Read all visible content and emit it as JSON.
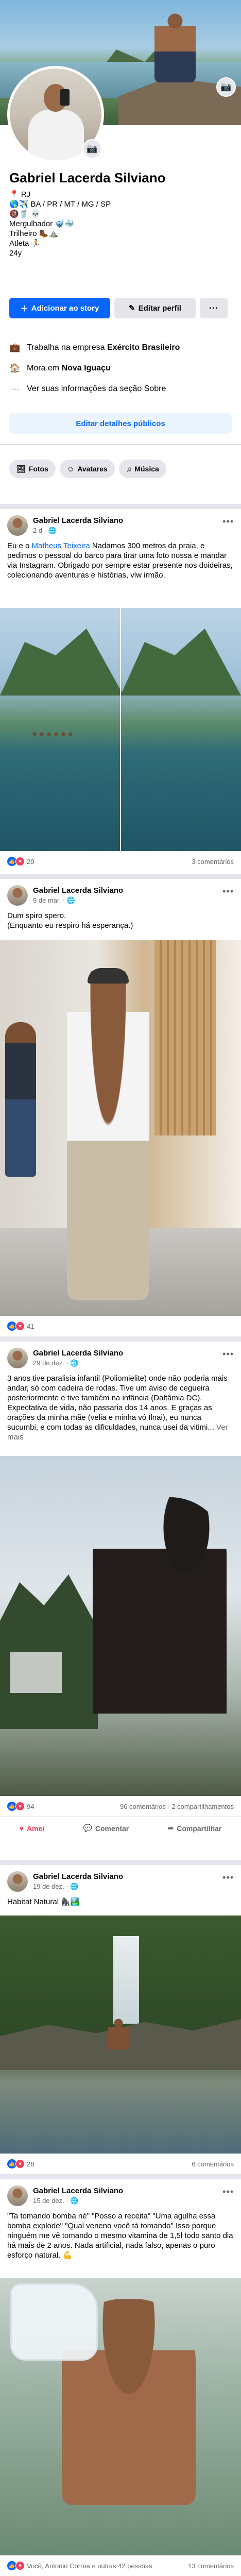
{
  "profile": {
    "name": "Gabriel Lacerda Silviano",
    "bio": [
      "📍 RJ",
      "🌎✈️ BA / PR / MT / MG / SP",
      "🔞🥤 💀",
      "Mergulhador 🤿🐳",
      "Trilheiro 🥾⛰️",
      "Atleta 🏃",
      "24y"
    ],
    "add_story_label": "Adicionar ao story",
    "edit_profile_label": "Editar perfil",
    "more_label": "···",
    "info": {
      "work_prefix": "Trabalha na empresa ",
      "work_company": "Exército Brasileiro",
      "home_prefix": "Mora em ",
      "home_city": "Nova Iguaçu",
      "about_text": "Ver suas informações da seção Sobre"
    },
    "details_label": "Editar detalhes públicos",
    "chips": [
      {
        "icon": "photos-icon",
        "label": "Fotos"
      },
      {
        "icon": "avatars-icon",
        "label": "Avatares"
      },
      {
        "icon": "music-icon",
        "label": "Música"
      }
    ]
  },
  "posts": [
    {
      "author": "Gabriel Lacerda Silviano",
      "time": "2 d · 🌐",
      "text_before": "Eu e o ",
      "mention": "Matheus Teixeira",
      "text_after": " Nadamos 300 metros da praia, e pedimos o pessoal do barco para tirar uma foto nossa e mandar via Instagram. Obrigado por sempre estar presente nos doideiras, colecionando aventuras e histórias, vlw irmão.",
      "reactions": "29",
      "stats_right": "3 comentários"
    },
    {
      "author": "Gabriel Lacerda Silviano",
      "time": "9 de mar. · 🌐",
      "text_lines": [
        "Dum spiro spero.",
        "(Enquanto eu respiro há esperança.)"
      ],
      "reactions": "41",
      "stats_right": ""
    },
    {
      "author": "Gabriel Lacerda Silviano",
      "time": "29 de dez. · 🌐",
      "text": "3 anos tive paralisia infantil (Poliomielite) onde não poderia mais andar, só com cadeira de rodas. Tive um aviso de cegueira posteriormente e tive também na infância (Daltâmia DC). Expectativa de vida, não passaria dos 14 anos. E graças as orações da minha mãe (velia e minha vó Ilnai), eu nunca sucumbi, e com todas as dificuldades, nunca usei da vitimi...",
      "see_more": "Ver mais",
      "reactions": "94",
      "stats_right": "96 comentários · 2 compartilhamentos",
      "actions": {
        "love": "Amei",
        "comment": "Comentar",
        "share": "Compartilhar"
      }
    },
    {
      "author": "Gabriel Lacerda Silviano",
      "time": "19 de dez. · 🌐",
      "text": "Habitat Natural 🦍🏞️",
      "reactions": "28",
      "stats_right": "6 comentários"
    },
    {
      "author": "Gabriel Lacerda Silviano",
      "time": "15 de dez. · 🌐",
      "text": "\"Ta tomando bomba né\" \"Posso a receita\" \"Uma agulha essa bomba explode\" \"Qual veneno você tá tomando\" Isso porque ninguém me vê tomando o mesmo vitamina de 1,5l todo santo dia há mais de 2 anos. Nada artificial, nada falso, apenas o puro esforço natural. 💪",
      "reactions_text": "Você, Antonio Correa e outras 42 pessoas",
      "stats_right": "13 comentários"
    }
  ],
  "colors": {
    "accent": "#0866ff",
    "love": "#f33e58",
    "muted": "#65676b",
    "bg": "#e4e6eb"
  }
}
